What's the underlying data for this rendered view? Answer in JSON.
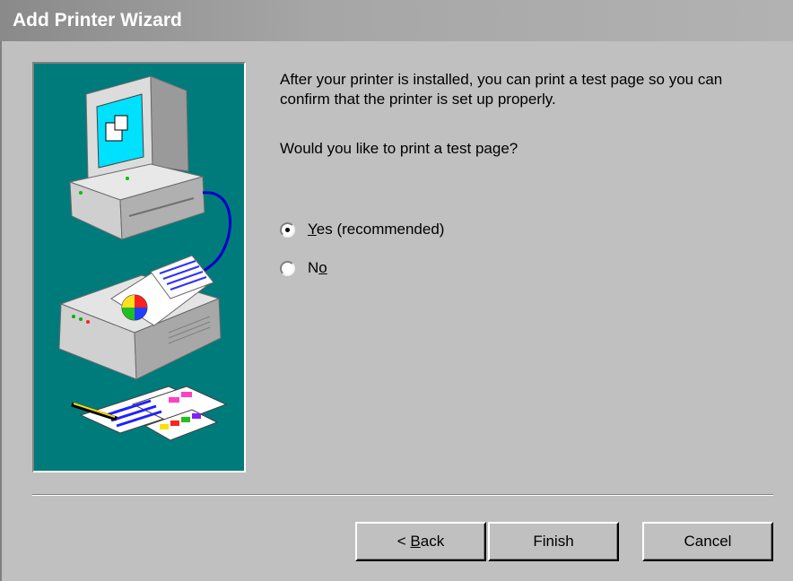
{
  "window": {
    "title": "Add Printer Wizard"
  },
  "content": {
    "paragraph1": "After your printer is installed, you can print a test page so you can confirm that the printer is set up properly.",
    "paragraph2": "Would you like to print a test page?"
  },
  "options": {
    "yes": {
      "mnemonic": "Y",
      "rest": "es (recommended)",
      "selected": true
    },
    "no": {
      "prefix": "N",
      "mnemonic": "o",
      "selected": false
    }
  },
  "buttons": {
    "back_prefix": "< ",
    "back_mnemonic": "B",
    "back_rest": "ack",
    "finish": "Finish",
    "cancel": "Cancel"
  },
  "colors": {
    "dialog_bg": "#c0c0c0",
    "illustration_bg": "#007b7b",
    "title_text": "#ffffff"
  },
  "icons": [
    "computer-icon",
    "printer-icon",
    "printed-pages-icon",
    "pencil-icon"
  ]
}
